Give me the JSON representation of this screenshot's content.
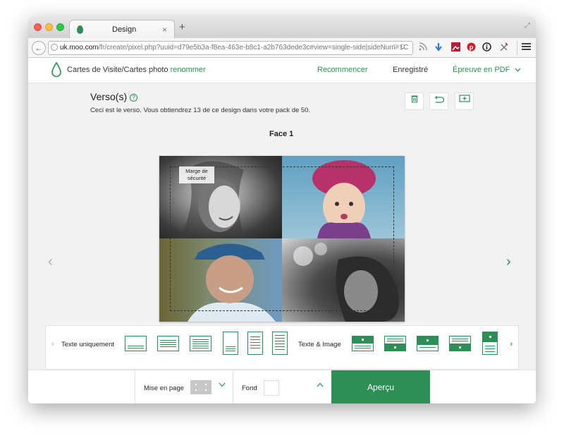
{
  "browser": {
    "tab_title": "Design",
    "tab_close": "×",
    "new_tab": "+",
    "url_host": "uk.moo.com",
    "url_path": "/fr/create/pixel.php?uuid=d79e5b3a-f8ea-463e-b8c1-a2b763dede3c#view=single-side|sideNum=1C",
    "url_arrows": "▽ C"
  },
  "header": {
    "brand": "Cartes de Visite/",
    "brand_bold": "Cartes photo",
    "rename": "renommer",
    "restart": "Recommencer",
    "saved": "Enregistré",
    "pdf_proof": "Épreuve en PDF"
  },
  "editor": {
    "title": "Verso(s)",
    "help": "?",
    "description": "Ceci est le verso. Vous obtiendrez 13 de ce design dans votre pack de 50.",
    "face_label": "Face 1",
    "safe_margin_label": "Marge de sécurité",
    "prev": "‹",
    "next": "›"
  },
  "layouts": {
    "text_only_label": "Texte uniquement",
    "text_image_label": "Texte & Image",
    "prev": "‹",
    "next": "›"
  },
  "bottom": {
    "layout_label": "Mise en page",
    "background_label": "Fond",
    "preview_button": "Aperçu"
  },
  "colors": {
    "accent": "#2d8e56"
  }
}
